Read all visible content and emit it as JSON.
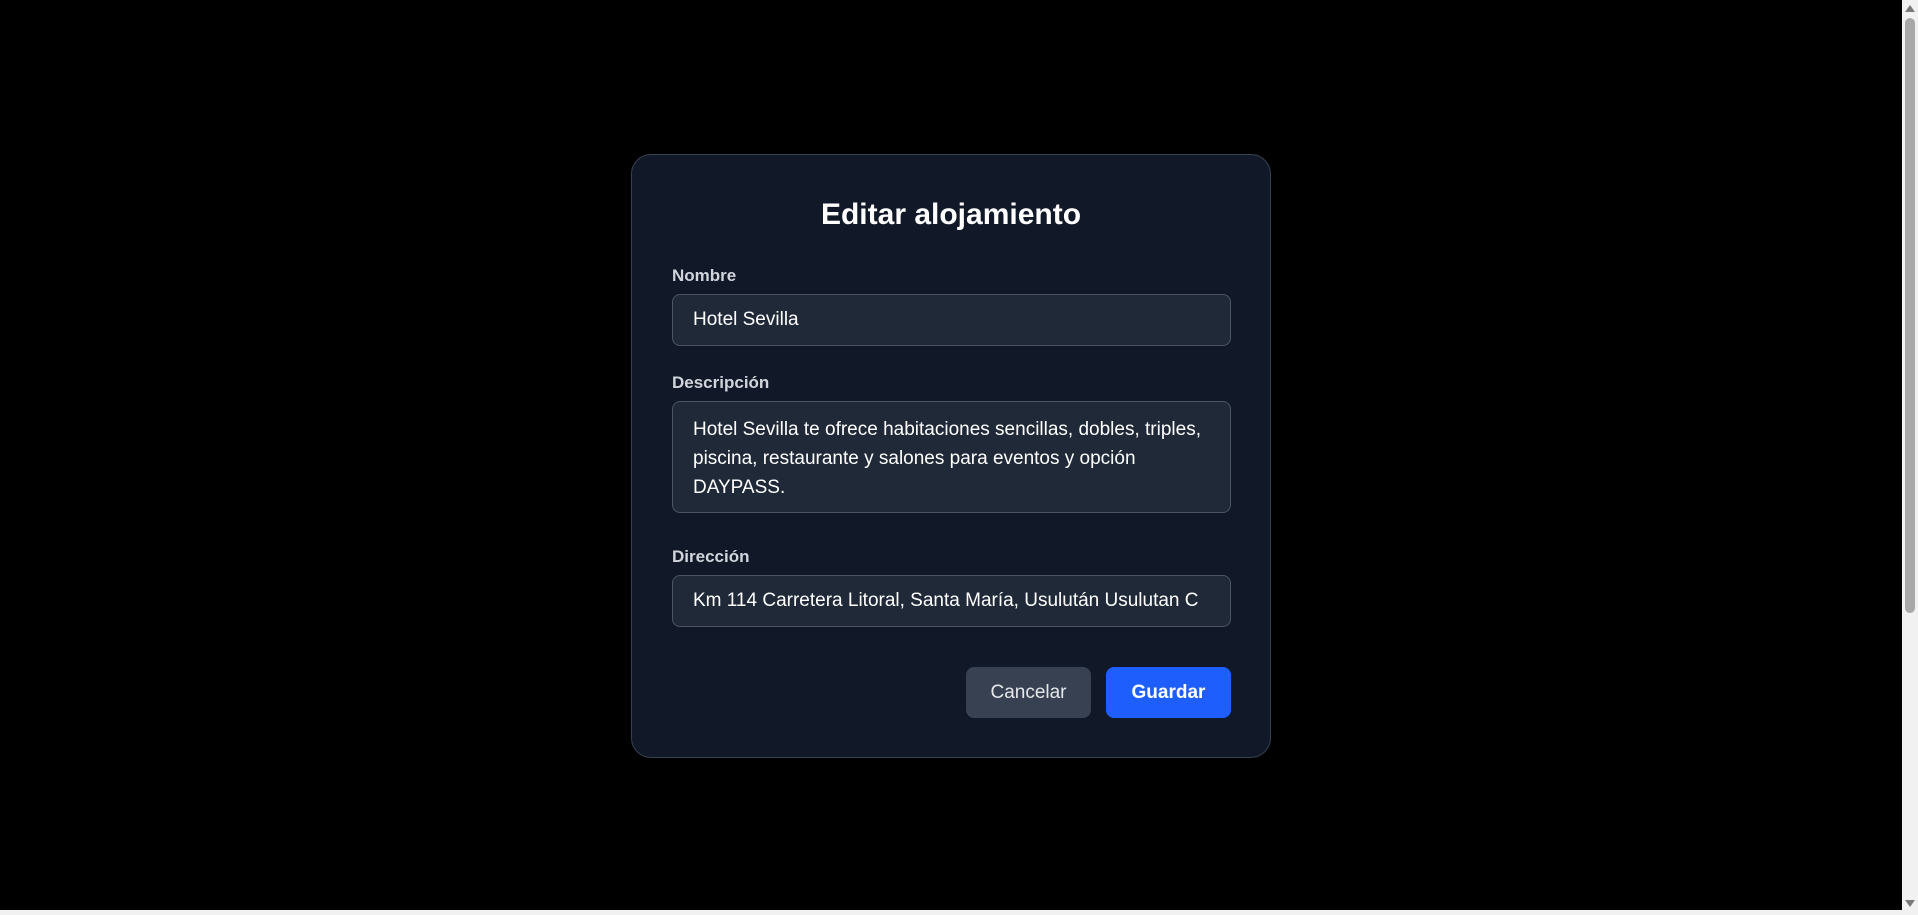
{
  "modal": {
    "title": "Editar alojamiento",
    "fields": {
      "nombre": {
        "label": "Nombre",
        "value": "Hotel Sevilla"
      },
      "descripcion": {
        "label": "Descripción",
        "value": "Hotel Sevilla te ofrece habitaciones sencillas, dobles, triples, piscina, restaurante y salones para eventos y opción DAYPASS."
      },
      "direccion": {
        "label": "Dirección",
        "value": "Km 114 Carretera Litoral, Santa María, Usulután Usulutan C"
      }
    },
    "buttons": {
      "cancel": "Cancelar",
      "save": "Guardar"
    }
  },
  "colors": {
    "background": "#000000",
    "modal": "#111827",
    "field": "#1f2937",
    "primary": "#1d5efc",
    "secondary": "#374151"
  },
  "icons": {
    "scroll_up": "triangle-up-icon",
    "scroll_down": "triangle-down-icon"
  }
}
